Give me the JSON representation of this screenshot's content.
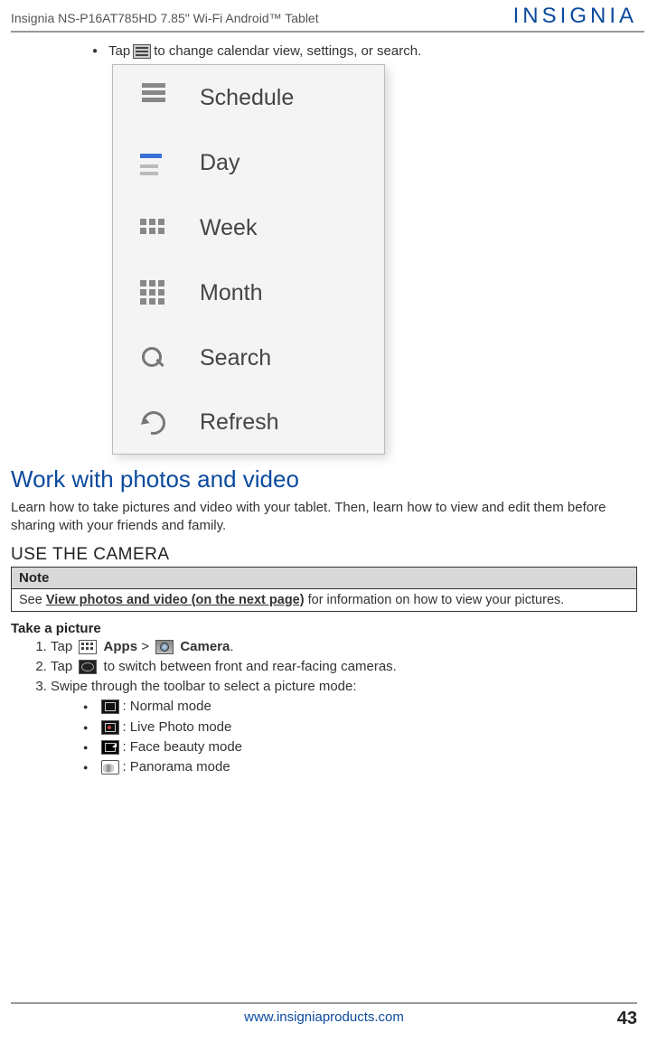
{
  "header": {
    "product": "Insignia  NS-P16AT785HD  7.85\" Wi-Fi Android™ Tablet",
    "brand": "INSIGNIA"
  },
  "topBullet": {
    "prefix": "Tap ",
    "suffix": " to change calendar view, settings, or search."
  },
  "calendarMenu": {
    "items": [
      "Schedule",
      "Day",
      "Week",
      "Month",
      "Search",
      "Refresh"
    ]
  },
  "section": {
    "heading": "Work with photos and video",
    "intro": "Learn how to take pictures and video with your tablet. Then, learn how to view and edit them before sharing with your friends and family.",
    "subheading": "USE THE CAMERA"
  },
  "note": {
    "header": "Note",
    "see": "See ",
    "linkText": "View photos and video (on the next page)",
    "tail": " for information on how to view your pictures."
  },
  "takePic": {
    "title": "Take a picture",
    "step1": {
      "prefix": "Tap ",
      "apps": "Apps",
      "gt": " > ",
      "camera": "Camera",
      "dot": "."
    },
    "step2": {
      "prefix": "Tap ",
      "suffix": " to switch between front and rear-facing cameras."
    },
    "step3": "Swipe through the toolbar to select a picture mode:",
    "modes": [
      ": Normal mode",
      ": Live Photo mode",
      ": Face beauty mode",
      ": Panorama mode"
    ]
  },
  "footer": {
    "url": "www.insigniaproducts.com"
  },
  "pageNumber": "43"
}
